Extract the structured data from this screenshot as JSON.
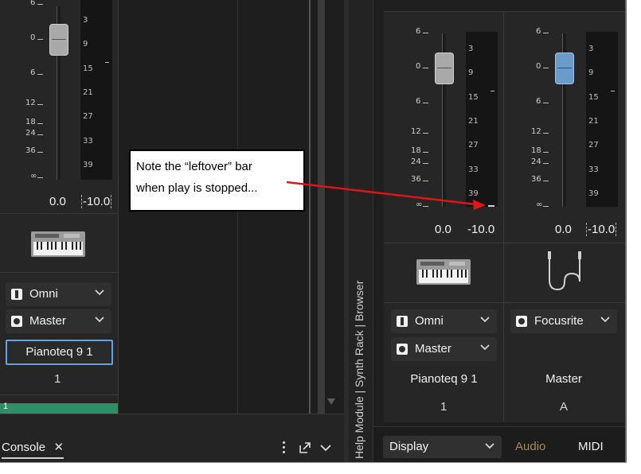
{
  "strip1": {
    "fader_scale": [
      "6",
      "0",
      "6",
      "12",
      "18",
      "24",
      "36",
      "∞"
    ],
    "meter_scale": [
      "3",
      "9",
      "15",
      "21",
      "27",
      "33",
      "39"
    ],
    "volume_readout": "0.0",
    "peak_readout": "-10.0",
    "input_select": "Omni",
    "output_select": "Master",
    "instrument_name": "Pianoteq 9 1",
    "channel_number": "1",
    "track_number": "1"
  },
  "strip2": {
    "fader_scale": [
      "6",
      "0",
      "6",
      "12",
      "18",
      "24",
      "36",
      "∞"
    ],
    "meter_scale": [
      "3",
      "9",
      "15",
      "21",
      "27",
      "33",
      "39"
    ],
    "volume_readout": "0.0",
    "peak_readout": "-10.0",
    "input_select": "Omni",
    "output_select": "Master",
    "instrument_name": "Pianoteq 9 1",
    "channel_number": "1"
  },
  "strip3": {
    "fader_scale": [
      "6",
      "0",
      "6",
      "12",
      "18",
      "24",
      "36",
      "∞"
    ],
    "meter_scale": [
      "3",
      "9",
      "15",
      "21",
      "27",
      "33",
      "39"
    ],
    "volume_readout": "0.0",
    "peak_readout": "-10.0",
    "input_select": "Focusrite",
    "bus_name": "Master",
    "channel_label": "A",
    "fader_color": "#6b9bc9"
  },
  "console_tab": {
    "label": "Console",
    "close_glyph": "✕"
  },
  "side_panel": {
    "label": "Help Module | Synth Rack | Browser"
  },
  "bottom_bar": {
    "display_select": "Display",
    "audio_label": "Audio",
    "midi_label": "MIDI"
  },
  "annotation": {
    "line1": "Note the “leftover” bar",
    "line2": "when play is stopped..."
  },
  "colors": {
    "panel_bg": "#1f1f1f",
    "strip_bg": "#2a2a2a",
    "accent_blue": "#5fa2e8",
    "track_green": "#2d8f66",
    "arrow_red": "#e01515"
  }
}
